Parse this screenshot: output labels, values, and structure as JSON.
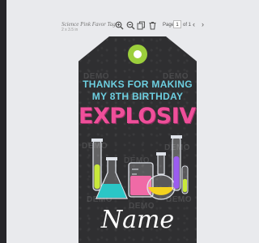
{
  "document": {
    "title": "Science Pink Favor Tag",
    "size": "2 x 3.5 in"
  },
  "toolbar": {
    "page_label": "Page",
    "page_value": "1",
    "page_of": "of 1",
    "prev": "‹",
    "next": "›"
  },
  "tag": {
    "line1": "THANKS FOR MAKING",
    "line2": "MY 8TH  BIRTHDAY",
    "headline": "EXPLOSIVE",
    "name": "Name",
    "watermark": "DEMO"
  },
  "colors": {
    "background": "#2f2f31",
    "hole_ring": "#9ccf3c",
    "text_teal": "#6dcfe0",
    "text_pink": "#ef4f9a",
    "liquid_green": "#c8e83a",
    "liquid_teal": "#2bc6c6",
    "liquid_pink": "#f06aa6",
    "liquid_yellow": "#f4d21f",
    "liquid_purple": "#9b5cf0"
  }
}
